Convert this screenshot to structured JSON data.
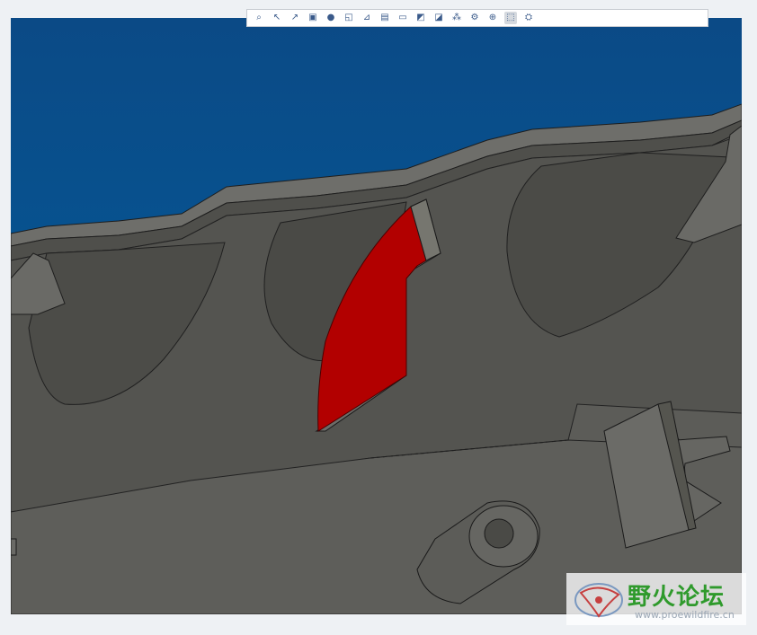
{
  "toolbar": {
    "buttons": [
      {
        "name": "zoom-fit-icon",
        "glyph": "⌕"
      },
      {
        "name": "arrow-left-icon",
        "glyph": "↖"
      },
      {
        "name": "arrow-right-icon",
        "glyph": "↗"
      },
      {
        "name": "orient-icon",
        "glyph": "▣"
      },
      {
        "name": "shading-icon",
        "glyph": "●"
      },
      {
        "name": "datum-plane-icon",
        "glyph": "◱"
      },
      {
        "name": "datum-axis-icon",
        "glyph": "⊿"
      },
      {
        "name": "sketch-icon",
        "glyph": "▤"
      },
      {
        "name": "view-manager-icon",
        "glyph": "▭"
      },
      {
        "name": "appearance-icon",
        "glyph": "◩"
      },
      {
        "name": "annotation-icon",
        "glyph": "◪"
      },
      {
        "name": "spin-center-icon",
        "glyph": "⁂"
      },
      {
        "name": "csys-icon",
        "glyph": "⚙"
      },
      {
        "name": "display-style-icon",
        "glyph": "⊕"
      },
      {
        "name": "saved-view-icon",
        "glyph": "⬚"
      },
      {
        "name": "selection-filter-icon",
        "glyph": "⛭"
      }
    ],
    "active_index": 14
  },
  "watermark": {
    "title": "野火论坛",
    "url": "www.proewildfire.cn"
  },
  "colors": {
    "background_top": "#0c4f8c",
    "model_gray": "#5a5a56",
    "selected_face": "#b20000"
  }
}
